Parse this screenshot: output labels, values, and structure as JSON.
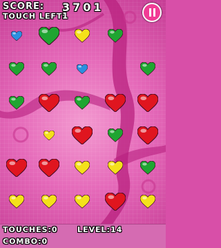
{
  "hud": {
    "score_label": "SCORE:",
    "score_value": "3701",
    "touch_left_label": "TOUCH LEFT:",
    "touch_left_value": "1"
  },
  "pause_icon": "pause-icon",
  "footer": {
    "touches": "TOUCHES:0",
    "level": "LEVEL:14",
    "combo": "COMBO:0"
  },
  "colors": {
    "red": "#e0151f",
    "green": "#1fa531",
    "yellow": "#f4e11a",
    "blue": "#2b8fe0",
    "background": "#d84fa8"
  },
  "board": {
    "rows": [
      [
        "blue-small",
        "green-big",
        "yellow-mid",
        "green-mid",
        "empty"
      ],
      [
        "green-mid",
        "green-mid",
        "blue-small",
        "empty",
        "green-mid"
      ],
      [
        "green-mid",
        "red-big",
        "green-mid",
        "red-big",
        "red-big"
      ],
      [
        "empty",
        "yellow-small",
        "red-big",
        "green-mid",
        "red-big"
      ],
      [
        "red-big",
        "red-big",
        "yellow-mid",
        "yellow-mid",
        "green-mid"
      ],
      [
        "yellow-mid",
        "yellow-mid",
        "yellow-mid",
        "red-big",
        "yellow-mid"
      ]
    ]
  }
}
